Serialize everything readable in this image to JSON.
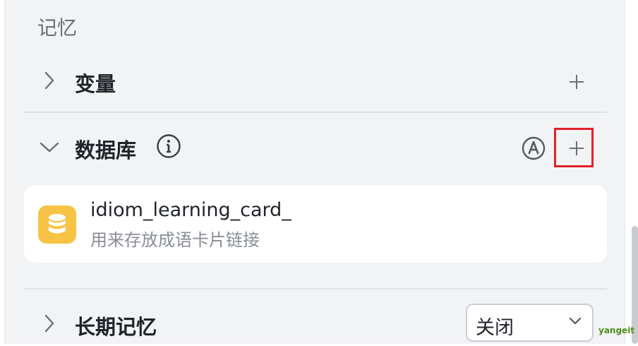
{
  "section": {
    "title": "记忆"
  },
  "variables": {
    "label": "变量",
    "expanded": false,
    "add_icon": "plus-icon"
  },
  "database": {
    "label": "数据库",
    "expanded": true,
    "info_icon": "info-icon",
    "auto_icon": "auto-A-icon",
    "add_icon": "plus-icon",
    "items": [
      {
        "name": "idiom_learning_card_",
        "description": "用来存放成语卡片链接",
        "icon": "database-icon",
        "icon_color": "#f6c344"
      }
    ]
  },
  "long_term_memory": {
    "label": "长期记忆",
    "expanded": false,
    "select_value": "关闭"
  },
  "watermark": "yangeit",
  "colors": {
    "highlight": "#e0212b",
    "panel_bg": "#f2f3f5",
    "db_icon": "#f6c344"
  }
}
